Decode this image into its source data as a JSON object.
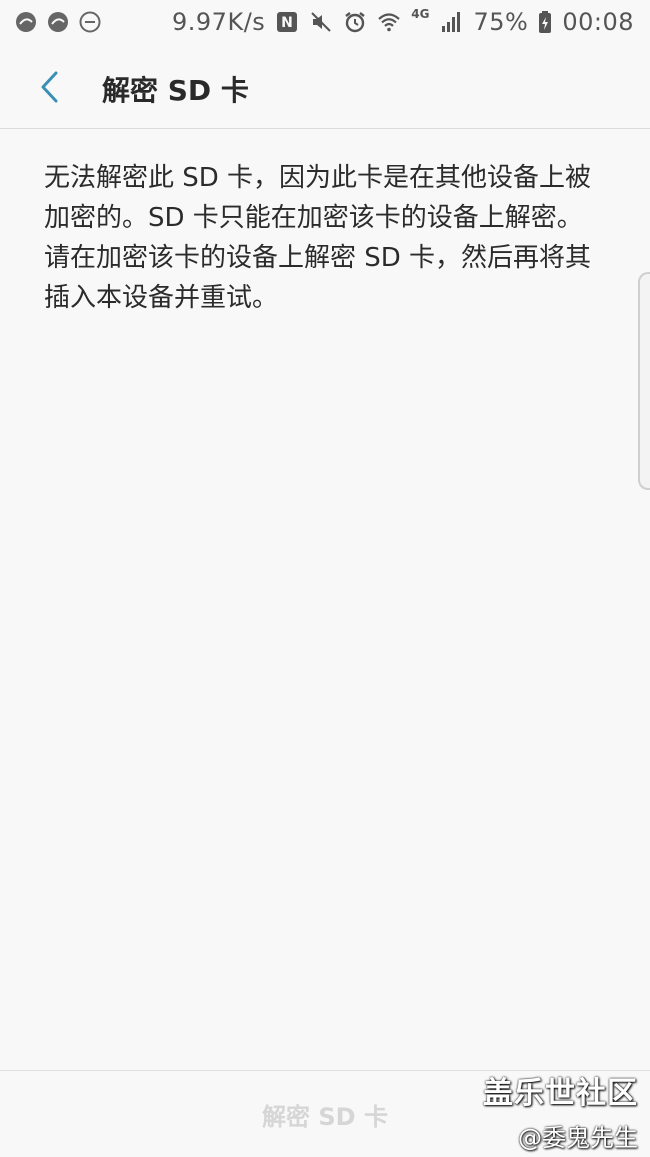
{
  "status_bar": {
    "left_icons": [
      "notification-app-icon",
      "notification-app-icon",
      "do-not-disturb-icon"
    ],
    "network_speed": "9.97K/s",
    "nfc_label": "N",
    "network_type": "4G",
    "battery": "75%",
    "time": "00:08"
  },
  "header": {
    "title": "解密 SD 卡"
  },
  "main": {
    "message": "无法解密此 SD 卡，因为此卡是在其他设备上被加密的。SD 卡只能在加密该卡的设备上解密。请在加密该卡的设备上解密 SD 卡，然后再将其插入本设备并重试。"
  },
  "bottom": {
    "decrypt_button_label": "解密 SD 卡"
  },
  "watermark": {
    "line1": "盖乐世社区",
    "line2": "@委鬼先生"
  },
  "colors": {
    "accent": "#3a8fb4",
    "background": "#f8f8f9",
    "disabled_text": "#d6d6d6"
  }
}
